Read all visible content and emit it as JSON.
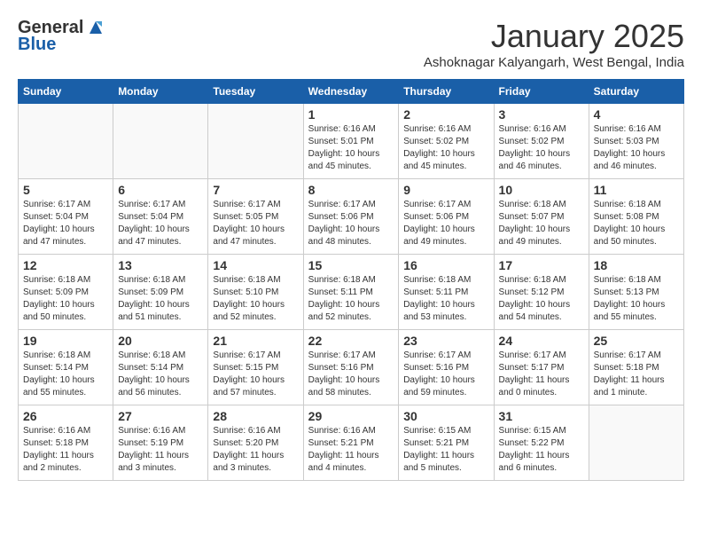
{
  "header": {
    "logo_line1": "General",
    "logo_line2": "Blue",
    "month": "January 2025",
    "location": "Ashoknagar Kalyangarh, West Bengal, India"
  },
  "days_of_week": [
    "Sunday",
    "Monday",
    "Tuesday",
    "Wednesday",
    "Thursday",
    "Friday",
    "Saturday"
  ],
  "weeks": [
    [
      {
        "day": "",
        "info": ""
      },
      {
        "day": "",
        "info": ""
      },
      {
        "day": "",
        "info": ""
      },
      {
        "day": "1",
        "info": "Sunrise: 6:16 AM\nSunset: 5:01 PM\nDaylight: 10 hours\nand 45 minutes."
      },
      {
        "day": "2",
        "info": "Sunrise: 6:16 AM\nSunset: 5:02 PM\nDaylight: 10 hours\nand 45 minutes."
      },
      {
        "day": "3",
        "info": "Sunrise: 6:16 AM\nSunset: 5:02 PM\nDaylight: 10 hours\nand 46 minutes."
      },
      {
        "day": "4",
        "info": "Sunrise: 6:16 AM\nSunset: 5:03 PM\nDaylight: 10 hours\nand 46 minutes."
      }
    ],
    [
      {
        "day": "5",
        "info": "Sunrise: 6:17 AM\nSunset: 5:04 PM\nDaylight: 10 hours\nand 47 minutes."
      },
      {
        "day": "6",
        "info": "Sunrise: 6:17 AM\nSunset: 5:04 PM\nDaylight: 10 hours\nand 47 minutes."
      },
      {
        "day": "7",
        "info": "Sunrise: 6:17 AM\nSunset: 5:05 PM\nDaylight: 10 hours\nand 47 minutes."
      },
      {
        "day": "8",
        "info": "Sunrise: 6:17 AM\nSunset: 5:06 PM\nDaylight: 10 hours\nand 48 minutes."
      },
      {
        "day": "9",
        "info": "Sunrise: 6:17 AM\nSunset: 5:06 PM\nDaylight: 10 hours\nand 49 minutes."
      },
      {
        "day": "10",
        "info": "Sunrise: 6:18 AM\nSunset: 5:07 PM\nDaylight: 10 hours\nand 49 minutes."
      },
      {
        "day": "11",
        "info": "Sunrise: 6:18 AM\nSunset: 5:08 PM\nDaylight: 10 hours\nand 50 minutes."
      }
    ],
    [
      {
        "day": "12",
        "info": "Sunrise: 6:18 AM\nSunset: 5:09 PM\nDaylight: 10 hours\nand 50 minutes."
      },
      {
        "day": "13",
        "info": "Sunrise: 6:18 AM\nSunset: 5:09 PM\nDaylight: 10 hours\nand 51 minutes."
      },
      {
        "day": "14",
        "info": "Sunrise: 6:18 AM\nSunset: 5:10 PM\nDaylight: 10 hours\nand 52 minutes."
      },
      {
        "day": "15",
        "info": "Sunrise: 6:18 AM\nSunset: 5:11 PM\nDaylight: 10 hours\nand 52 minutes."
      },
      {
        "day": "16",
        "info": "Sunrise: 6:18 AM\nSunset: 5:11 PM\nDaylight: 10 hours\nand 53 minutes."
      },
      {
        "day": "17",
        "info": "Sunrise: 6:18 AM\nSunset: 5:12 PM\nDaylight: 10 hours\nand 54 minutes."
      },
      {
        "day": "18",
        "info": "Sunrise: 6:18 AM\nSunset: 5:13 PM\nDaylight: 10 hours\nand 55 minutes."
      }
    ],
    [
      {
        "day": "19",
        "info": "Sunrise: 6:18 AM\nSunset: 5:14 PM\nDaylight: 10 hours\nand 55 minutes."
      },
      {
        "day": "20",
        "info": "Sunrise: 6:18 AM\nSunset: 5:14 PM\nDaylight: 10 hours\nand 56 minutes."
      },
      {
        "day": "21",
        "info": "Sunrise: 6:17 AM\nSunset: 5:15 PM\nDaylight: 10 hours\nand 57 minutes."
      },
      {
        "day": "22",
        "info": "Sunrise: 6:17 AM\nSunset: 5:16 PM\nDaylight: 10 hours\nand 58 minutes."
      },
      {
        "day": "23",
        "info": "Sunrise: 6:17 AM\nSunset: 5:16 PM\nDaylight: 10 hours\nand 59 minutes."
      },
      {
        "day": "24",
        "info": "Sunrise: 6:17 AM\nSunset: 5:17 PM\nDaylight: 11 hours\nand 0 minutes."
      },
      {
        "day": "25",
        "info": "Sunrise: 6:17 AM\nSunset: 5:18 PM\nDaylight: 11 hours\nand 1 minute."
      }
    ],
    [
      {
        "day": "26",
        "info": "Sunrise: 6:16 AM\nSunset: 5:18 PM\nDaylight: 11 hours\nand 2 minutes."
      },
      {
        "day": "27",
        "info": "Sunrise: 6:16 AM\nSunset: 5:19 PM\nDaylight: 11 hours\nand 3 minutes."
      },
      {
        "day": "28",
        "info": "Sunrise: 6:16 AM\nSunset: 5:20 PM\nDaylight: 11 hours\nand 3 minutes."
      },
      {
        "day": "29",
        "info": "Sunrise: 6:16 AM\nSunset: 5:21 PM\nDaylight: 11 hours\nand 4 minutes."
      },
      {
        "day": "30",
        "info": "Sunrise: 6:15 AM\nSunset: 5:21 PM\nDaylight: 11 hours\nand 5 minutes."
      },
      {
        "day": "31",
        "info": "Sunrise: 6:15 AM\nSunset: 5:22 PM\nDaylight: 11 hours\nand 6 minutes."
      },
      {
        "day": "",
        "info": ""
      }
    ]
  ]
}
